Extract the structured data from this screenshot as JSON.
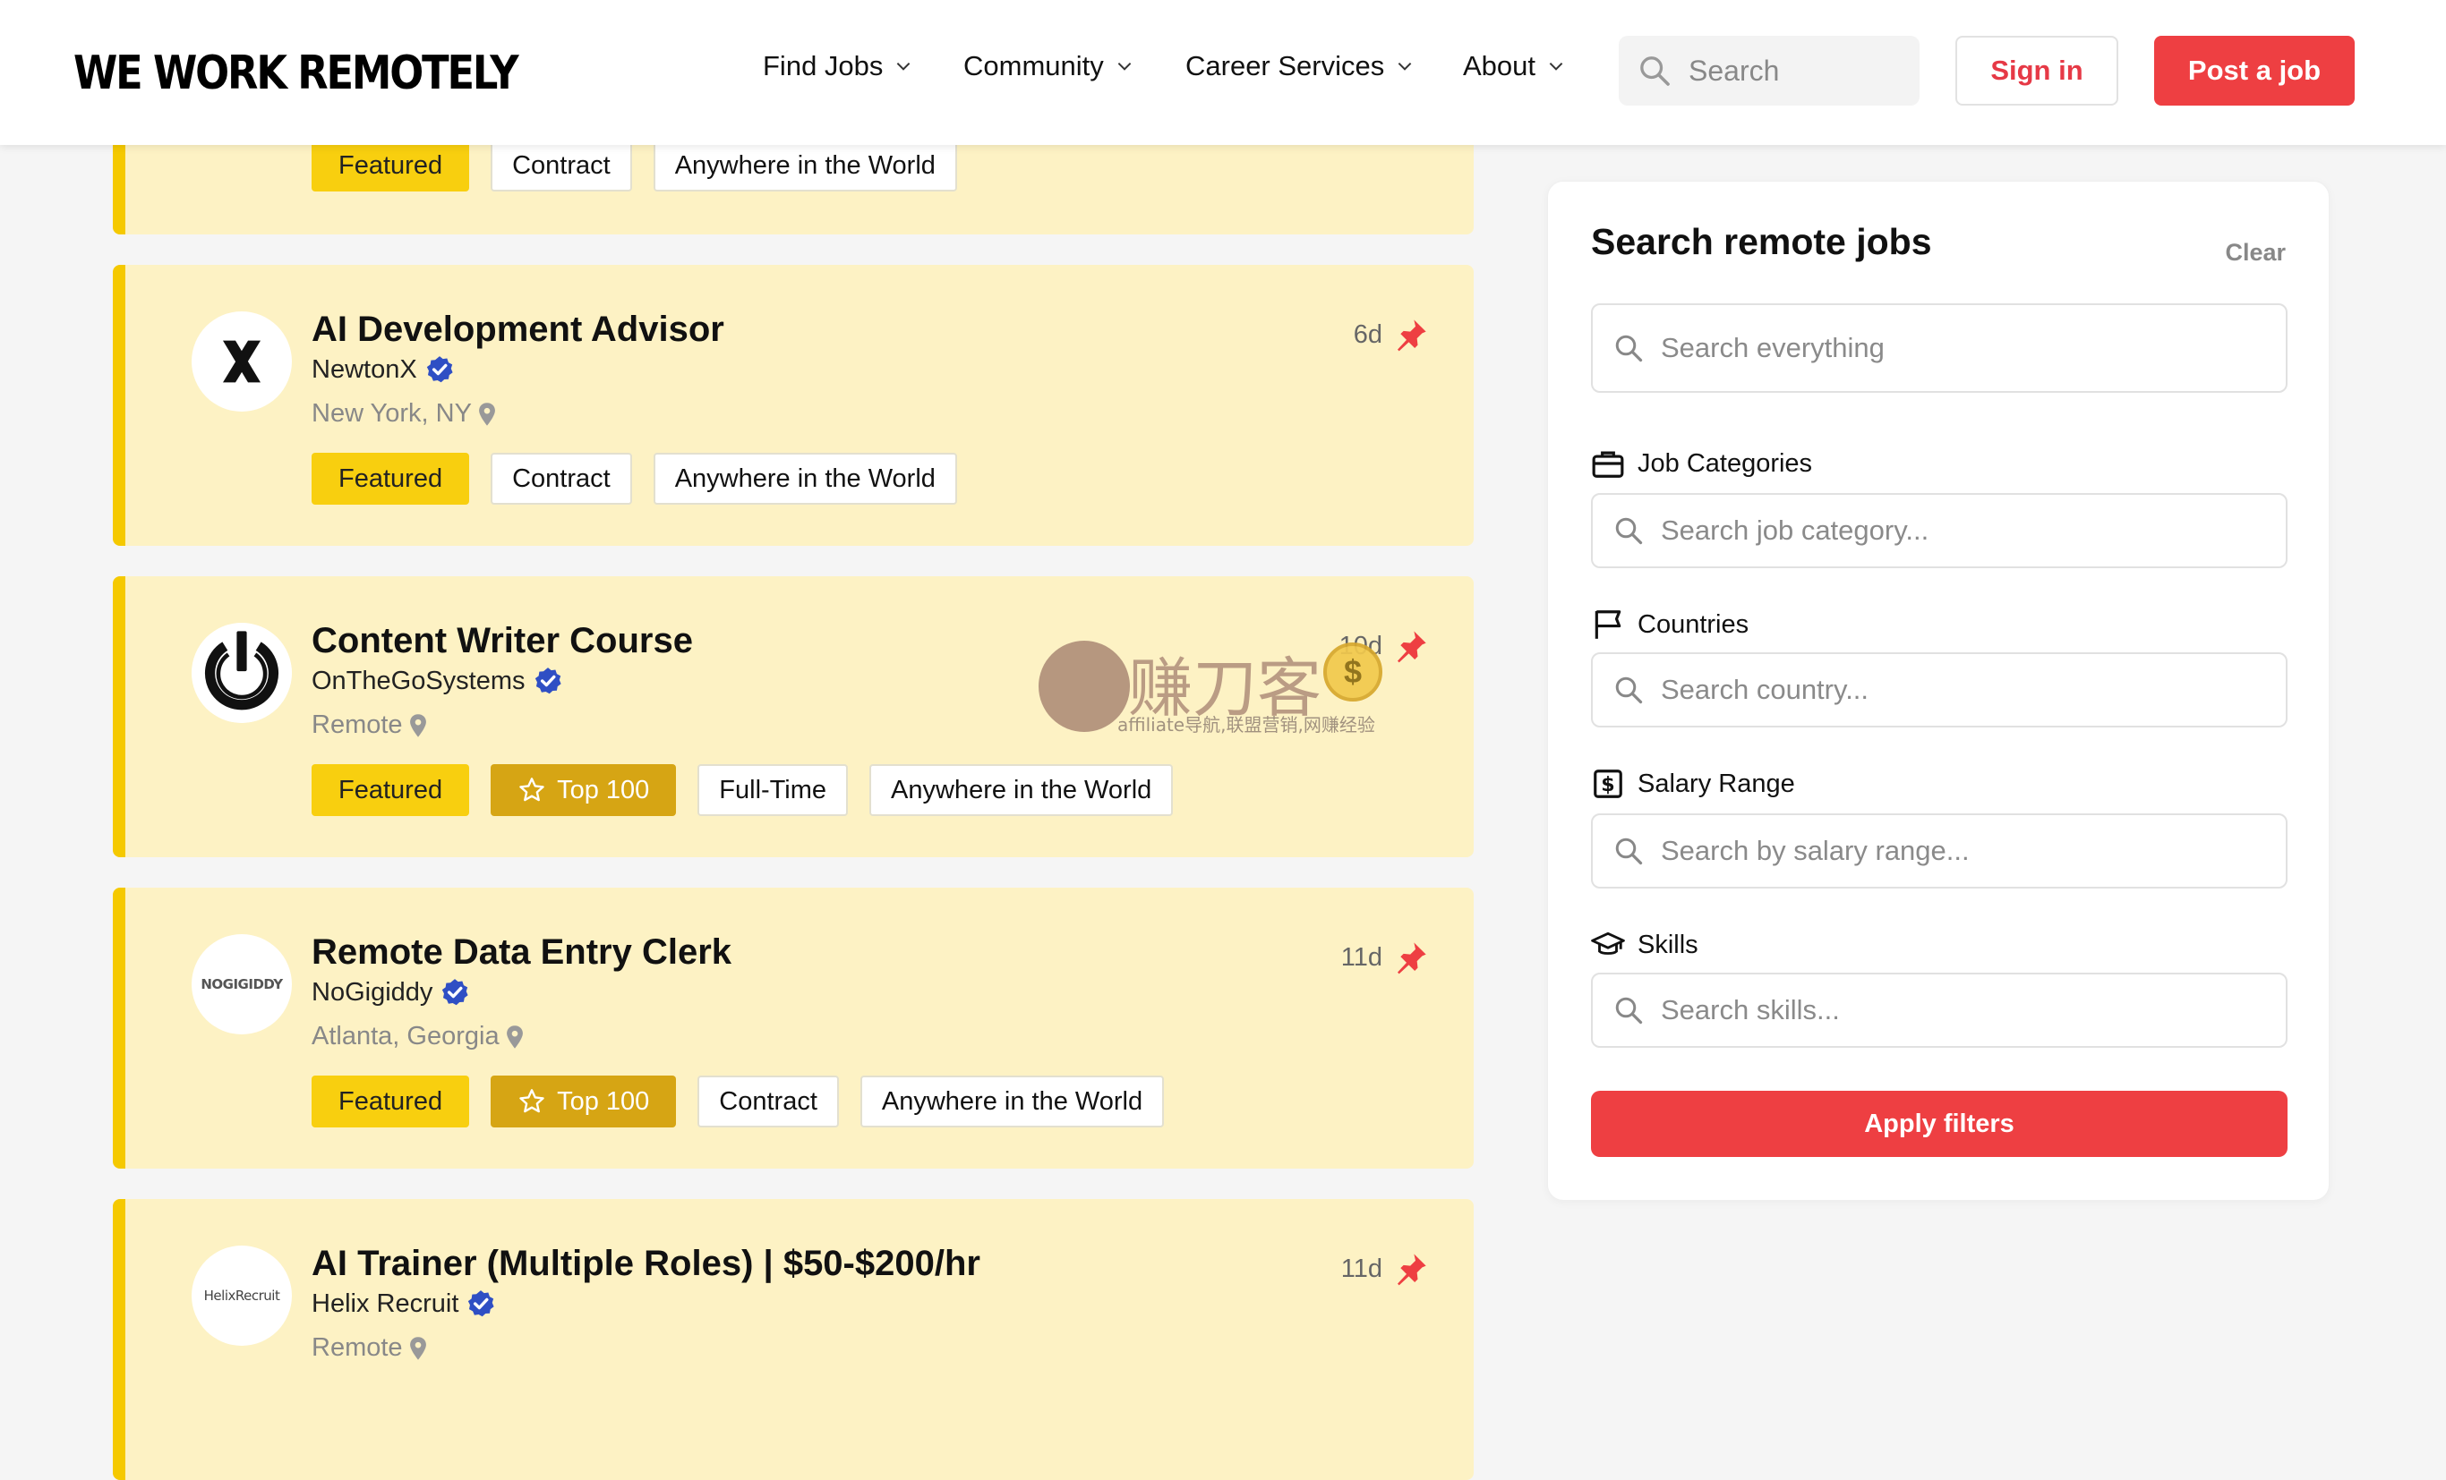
{
  "brand": {
    "logo_text": "WE WORK REMOTELY"
  },
  "nav": {
    "items": [
      {
        "label": "Find Jobs"
      },
      {
        "label": "Community"
      },
      {
        "label": "Career Services"
      },
      {
        "label": "About"
      }
    ],
    "search_placeholder": "Search",
    "signin_label": "Sign in",
    "post_job_label": "Post a job"
  },
  "jobs": [
    {
      "tags": [
        "Featured",
        "Contract",
        "Anywhere in the World"
      ]
    },
    {
      "title": "AI Development Advisor",
      "company": "NewtonX",
      "location": "New York, NY",
      "age": "6d",
      "logo_icon": "newtonx-x-logo",
      "tags": [
        "Featured",
        "Contract",
        "Anywhere in the World"
      ]
    },
    {
      "title": "Content Writer Course",
      "company": "OnTheGoSystems",
      "location": "Remote",
      "age": "10d",
      "logo_icon": "power-symbol-logo",
      "tags": [
        "Featured",
        "Top 100",
        "Full-Time",
        "Anywhere in the World"
      ]
    },
    {
      "title": "Remote Data Entry Clerk",
      "company": "NoGigiddy",
      "location": "Atlanta, Georgia",
      "age": "11d",
      "logo_text": "NOGIGIDDY",
      "tags": [
        "Featured",
        "Top 100",
        "Contract",
        "Anywhere in the World"
      ]
    },
    {
      "title": "AI Trainer (Multiple Roles) | $50-$200/hr",
      "company": "Helix Recruit",
      "location": "Remote",
      "age": "11d",
      "logo_text": "HelixRecruit",
      "tags": []
    }
  ],
  "watermark": {
    "title": "赚刀客",
    "subtitle": "affiliate导航,联盟营销,网赚经验",
    "coin_symbol": "$"
  },
  "sidebar": {
    "title": "Search remote jobs",
    "clear_label": "Clear",
    "search_placeholder": "Search everything",
    "categories_label": "Job Categories",
    "categories_placeholder": "Search job category...",
    "countries_label": "Countries",
    "countries_placeholder": "Search country...",
    "salary_label": "Salary Range",
    "salary_placeholder": "Search by salary range...",
    "skills_label": "Skills",
    "skills_placeholder": "Search skills...",
    "apply_label": "Apply filters"
  },
  "colors": {
    "accent_red": "#ee3f42",
    "card_bg": "#fdf2c4",
    "card_border": "#f5c900",
    "featured_tag": "#f8cf0f",
    "top100_tag": "#d6a514",
    "verified_blue": "#2f4fc4"
  }
}
